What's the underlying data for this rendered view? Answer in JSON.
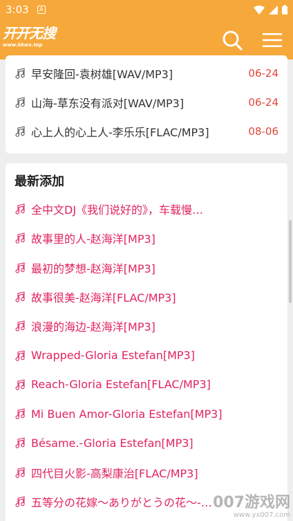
{
  "status": {
    "time": "3:03",
    "notif_glyph": "A"
  },
  "app": {
    "logo_main": "开开无搜",
    "logo_url": "www.kkws.top",
    "accent": "#f7a83a"
  },
  "recent": [
    {
      "title": "早安隆回-袁树雄[WAV/MP3]",
      "date": "06-24"
    },
    {
      "title": "山海-草东没有派对[WAV/MP3]",
      "date": "06-24"
    },
    {
      "title": "心上人的心上人-李乐乐[FLAC/MP3]",
      "date": "08-06"
    }
  ],
  "latest": {
    "heading": "最新添加",
    "items": [
      "全中文DJ《我们说好的》，车载慢…",
      "故事里的人-赵海洋[MP3]",
      "最初的梦想-赵海洋[MP3]",
      "故事很美-赵海洋[FLAC/MP3]",
      "浪漫的海边-赵海洋[MP3]",
      "Wrapped-Gloria Estefan[MP3]",
      "Reach-Gloria Estefan[FLAC/MP3]",
      "Mi Buen Amor-Gloria Estefan[MP3]",
      "Bésame.-Gloria Estefan[MP3]",
      "四代目火影-高梨康治[FLAC/MP3]",
      "五等分の花嫁～ありがとうの花～-…"
    ]
  },
  "watermark": {
    "main": "007游戏网",
    "url": "www.yx007.com"
  },
  "icons": {
    "search": "search-icon",
    "menu": "menu-icon",
    "note": "music-note-icon"
  }
}
